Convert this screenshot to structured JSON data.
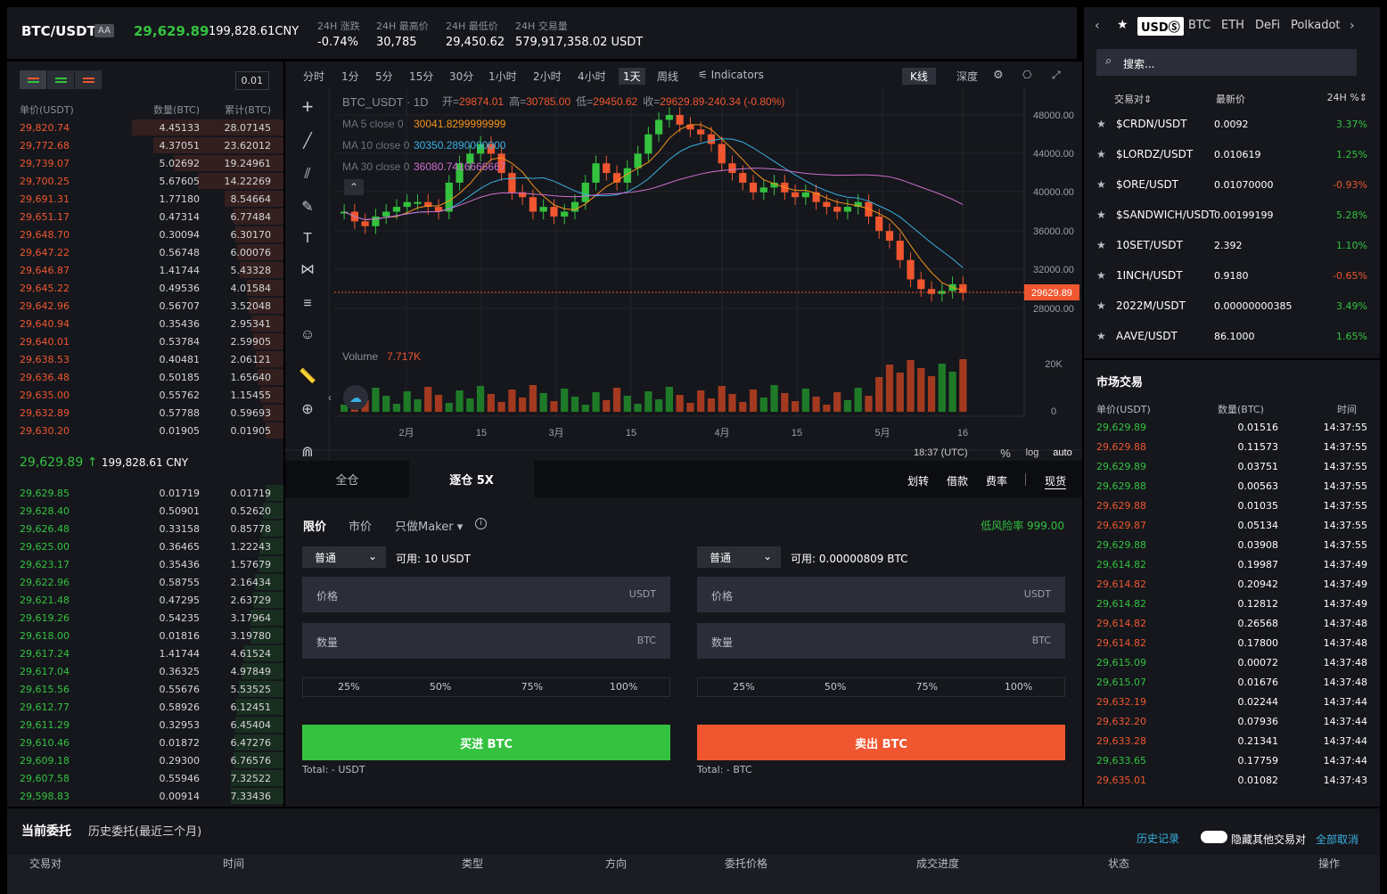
{
  "header": {
    "pair": "BTC/USDT",
    "tag": "AA",
    "last_price": "29,629.89",
    "last_cny": "199,828.61CNY",
    "stats": [
      {
        "label": "24H 涨跌",
        "value": "-0.74%"
      },
      {
        "label": "24H 最高价",
        "value": "30,785"
      },
      {
        "label": "24H 最低价",
        "value": "29,450.62"
      },
      {
        "label": "24H 交易量",
        "value": "579,917,358.02 USDT"
      }
    ]
  },
  "orderbook": {
    "step": "0.01",
    "headers": [
      "单价(USDT)",
      "数量(BTC)",
      "累计(BTC)"
    ],
    "asks": [
      [
        "29,820.74",
        "4.45133",
        "28.07145"
      ],
      [
        "29,772.68",
        "4.37051",
        "23.62012"
      ],
      [
        "29,739.07",
        "5.02692",
        "19.24961"
      ],
      [
        "29,700.25",
        "5.67605",
        "14.22269"
      ],
      [
        "29,691.31",
        "1.77180",
        "8.54664"
      ],
      [
        "29,651.17",
        "0.47314",
        "6.77484"
      ],
      [
        "29,648.70",
        "0.30094",
        "6.30170"
      ],
      [
        "29,647.22",
        "0.56748",
        "6.00076"
      ],
      [
        "29,646.87",
        "1.41744",
        "5.43328"
      ],
      [
        "29,645.22",
        "0.49536",
        "4.01584"
      ],
      [
        "29,642.96",
        "0.56707",
        "3.52048"
      ],
      [
        "29,640.94",
        "0.35436",
        "2.95341"
      ],
      [
        "29,640.01",
        "0.53784",
        "2.59905"
      ],
      [
        "29,638.53",
        "0.40481",
        "2.06121"
      ],
      [
        "29,636.48",
        "0.50185",
        "1.65640"
      ],
      [
        "29,635.00",
        "0.55762",
        "1.15455"
      ],
      [
        "29,632.89",
        "0.57788",
        "0.59693"
      ],
      [
        "29,630.20",
        "0.01905",
        "0.01905"
      ]
    ],
    "mid_price": "29,629.89",
    "mid_arrow": "↑",
    "mid_cny": "199,828.61 CNY",
    "bids": [
      [
        "29,629.85",
        "0.01719",
        "0.01719"
      ],
      [
        "29,628.40",
        "0.50901",
        "0.52620"
      ],
      [
        "29,626.48",
        "0.33158",
        "0.85778"
      ],
      [
        "29,625.00",
        "0.36465",
        "1.22243"
      ],
      [
        "29,623.17",
        "0.35436",
        "1.57679"
      ],
      [
        "29,622.96",
        "0.58755",
        "2.16434"
      ],
      [
        "29,621.48",
        "0.47295",
        "2.63729"
      ],
      [
        "29,619.26",
        "0.54235",
        "3.17964"
      ],
      [
        "29,618.00",
        "0.01816",
        "3.19780"
      ],
      [
        "29,617.24",
        "1.41744",
        "4.61524"
      ],
      [
        "29,617.04",
        "0.36325",
        "4.97849"
      ],
      [
        "29,615.56",
        "0.55676",
        "5.53525"
      ],
      [
        "29,612.77",
        "0.58926",
        "6.12451"
      ],
      [
        "29,611.29",
        "0.32953",
        "6.45404"
      ],
      [
        "29,610.46",
        "0.01872",
        "6.47276"
      ],
      [
        "29,609.18",
        "0.29300",
        "6.76576"
      ],
      [
        "29,607.58",
        "0.55946",
        "7.32522"
      ],
      [
        "29,598.83",
        "0.00914",
        "7.33436"
      ]
    ]
  },
  "chart": {
    "intervals": [
      "分时",
      "1分",
      "5分",
      "15分",
      "30分",
      "1小时",
      "2小时",
      "4小时",
      "1天",
      "周线"
    ],
    "active_interval": "1天",
    "indicators": "Indicators",
    "view_kline": "K线",
    "view_depth": "深度",
    "legend_symbol": "BTC_USDT · 1D",
    "ohlc": {
      "open_label": "开=",
      "open": "29874.01",
      "high_label": "高=",
      "high": "30785.00",
      "low_label": "低=",
      "low": "29450.62",
      "close_label": "收=",
      "close": "29629.89",
      "change": "-240.34 (-0.80%)"
    },
    "ma": [
      {
        "label": "MA 5 close 0",
        "value": "30041.8299999999",
        "color": "#f7931a"
      },
      {
        "label": "MA 10 close 0",
        "value": "30350.2890000000",
        "color": "#3ab0e2"
      },
      {
        "label": "MA 30 close 0",
        "value": "36080.7416666667",
        "color": "#d070d0"
      }
    ],
    "price_ticks": [
      "48000.00",
      "44000.00",
      "40000.00",
      "36000.00",
      "32000.00",
      "28000.00"
    ],
    "current_price": "29629.89",
    "x_ticks": [
      "2月",
      "15",
      "3月",
      "15",
      "4月",
      "15",
      "5月",
      "16"
    ],
    "volume_label": "Volume",
    "volume_value": "7.717K",
    "volume_ticks": [
      "20K",
      "0"
    ],
    "time": "18:37 (UTC)",
    "percent": "%",
    "log": "log",
    "auto": "auto"
  },
  "trade": {
    "margin_tabs": [
      "全仓",
      "逐仓 5X"
    ],
    "links": [
      "划转",
      "借款",
      "费率",
      "现货"
    ],
    "order_types": [
      "限价",
      "市价",
      "只做Maker"
    ],
    "risk": "低风险率 999.00",
    "buy": {
      "mode": "普通",
      "avail_label": "可用:",
      "avail": "10 USDT",
      "price": "价格",
      "price_unit": "USDT",
      "amount": "数量",
      "amount_unit": "BTC",
      "button": "买进 BTC",
      "total": "Total: - USDT"
    },
    "sell": {
      "mode": "普通",
      "avail_label": "可用:",
      "avail": "0.00000809 BTC",
      "price": "价格",
      "price_unit": "USDT",
      "amount": "数量",
      "amount_unit": "BTC",
      "button": "卖出 BTC",
      "total": "Total: - BTC"
    },
    "percents": [
      "25%",
      "50%",
      "75%",
      "100%"
    ]
  },
  "market": {
    "tabs": [
      "USDⓈ",
      "BTC",
      "ETH",
      "DeFi",
      "Polkadot"
    ],
    "search_placeholder": "搜索...",
    "headers": [
      "交易对",
      "最新价",
      "24H %"
    ],
    "pairs": [
      [
        "$CRDN/USDT",
        "0.0092",
        "3.37%"
      ],
      [
        "$LORDZ/USDT",
        "0.010619",
        "1.25%"
      ],
      [
        "$ORE/USDT",
        "0.01070000",
        "-0.93%"
      ],
      [
        "$SANDWICH/USDT",
        "0.00199199",
        "5.28%"
      ],
      [
        "10SET/USDT",
        "2.392",
        "1.10%"
      ],
      [
        "1INCH/USDT",
        "0.9180",
        "-0.65%"
      ],
      [
        "2022M/USDT",
        "0.00000000385",
        "3.49%"
      ],
      [
        "AAVE/USDT",
        "86.1000",
        "1.65%"
      ]
    ],
    "trades_title": "市场交易",
    "trade_headers": [
      "单价(USDT)",
      "数量(BTC)",
      "时间"
    ],
    "trades": [
      [
        "29,629.89",
        "0.01516",
        "14:37:55",
        "g"
      ],
      [
        "29,629.88",
        "0.11573",
        "14:37:55",
        "r"
      ],
      [
        "29,629.89",
        "0.03751",
        "14:37:55",
        "g"
      ],
      [
        "29,629.88",
        "0.00563",
        "14:37:55",
        "g"
      ],
      [
        "29,629.88",
        "0.01035",
        "14:37:55",
        "r"
      ],
      [
        "29,629.87",
        "0.05134",
        "14:37:55",
        "r"
      ],
      [
        "29,629.88",
        "0.03908",
        "14:37:55",
        "g"
      ],
      [
        "29,614.82",
        "0.19987",
        "14:37:49",
        "g"
      ],
      [
        "29,614.82",
        "0.20942",
        "14:37:49",
        "r"
      ],
      [
        "29,614.82",
        "0.12812",
        "14:37:49",
        "g"
      ],
      [
        "29,614.82",
        "0.26568",
        "14:37:48",
        "r"
      ],
      [
        "29,614.82",
        "0.17800",
        "14:37:48",
        "r"
      ],
      [
        "29,615.09",
        "0.00072",
        "14:37:48",
        "g"
      ],
      [
        "29,615.07",
        "0.01676",
        "14:37:48",
        "g"
      ],
      [
        "29,632.19",
        "0.02244",
        "14:37:44",
        "r"
      ],
      [
        "29,632.20",
        "0.07936",
        "14:37:44",
        "r"
      ],
      [
        "29,633.28",
        "0.21341",
        "14:37:44",
        "r"
      ],
      [
        "29,633.65",
        "0.17759",
        "14:37:44",
        "g"
      ],
      [
        "29,635.01",
        "0.01082",
        "14:37:43",
        "r"
      ]
    ]
  },
  "orders": {
    "tabs": [
      "当前委托",
      "历史委托(最近三个月)"
    ],
    "history": "历史记录",
    "hide_label": "隐藏其他交易对",
    "cancel_all": "全部取消",
    "columns": [
      "交易对",
      "时间",
      "类型",
      "方向",
      "委托价格",
      "成交进度",
      "状态",
      "操作"
    ]
  },
  "colors": {
    "up": "#34c23f",
    "down": "#f0562f",
    "bg": "#15171c"
  }
}
